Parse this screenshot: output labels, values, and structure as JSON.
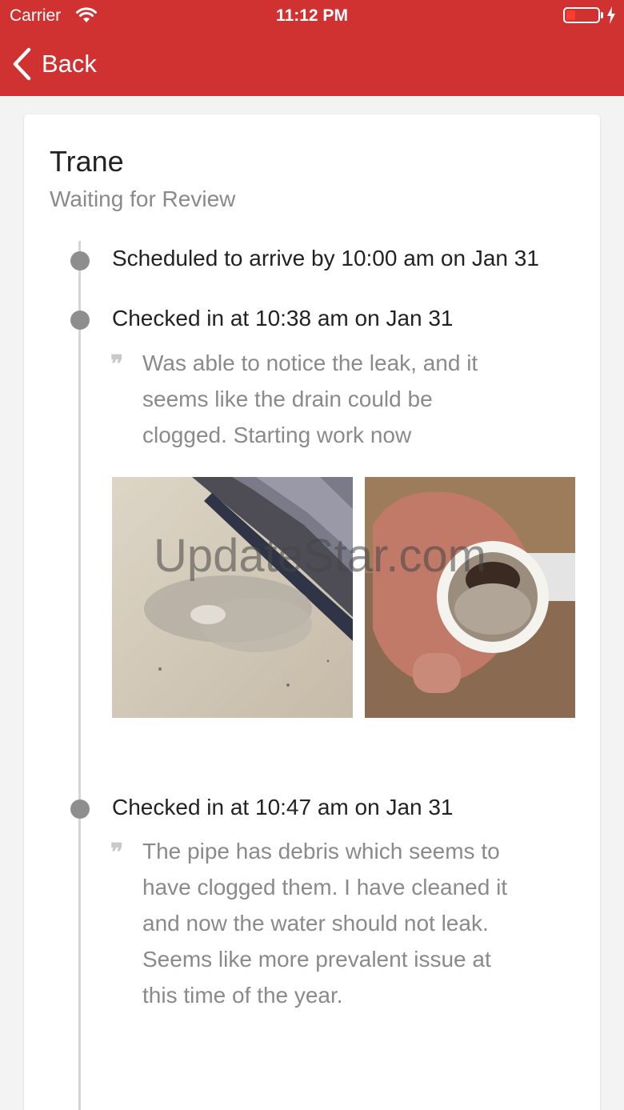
{
  "status_bar": {
    "carrier": "Carrier",
    "time": "11:12 PM"
  },
  "nav": {
    "back_label": "Back"
  },
  "card": {
    "title": "Trane",
    "status": "Waiting for Review",
    "events": [
      {
        "text": "Scheduled to arrive by 10:00 am on Jan 31"
      },
      {
        "text": "Checked in at 10:38 am on Jan 31",
        "note": "Was able to notice the leak, and it seems like the drain could be clogged. Starting work now"
      },
      {
        "text": "Checked in at 10:47 am on Jan 31",
        "note": "The pipe has debris which seems to have clogged them. I have cleaned it and now the water should not leak. Seems like more prevalent issue at this time of the year."
      }
    ],
    "photos": [
      "water-leak-photo",
      "clogged-pipe-photo"
    ],
    "watermark": "UpdateStar.com"
  },
  "colors": {
    "header": "#d03232",
    "background": "#f3f3f3",
    "dot": "#8e8e8e",
    "timeline": "#d5d5d5"
  }
}
